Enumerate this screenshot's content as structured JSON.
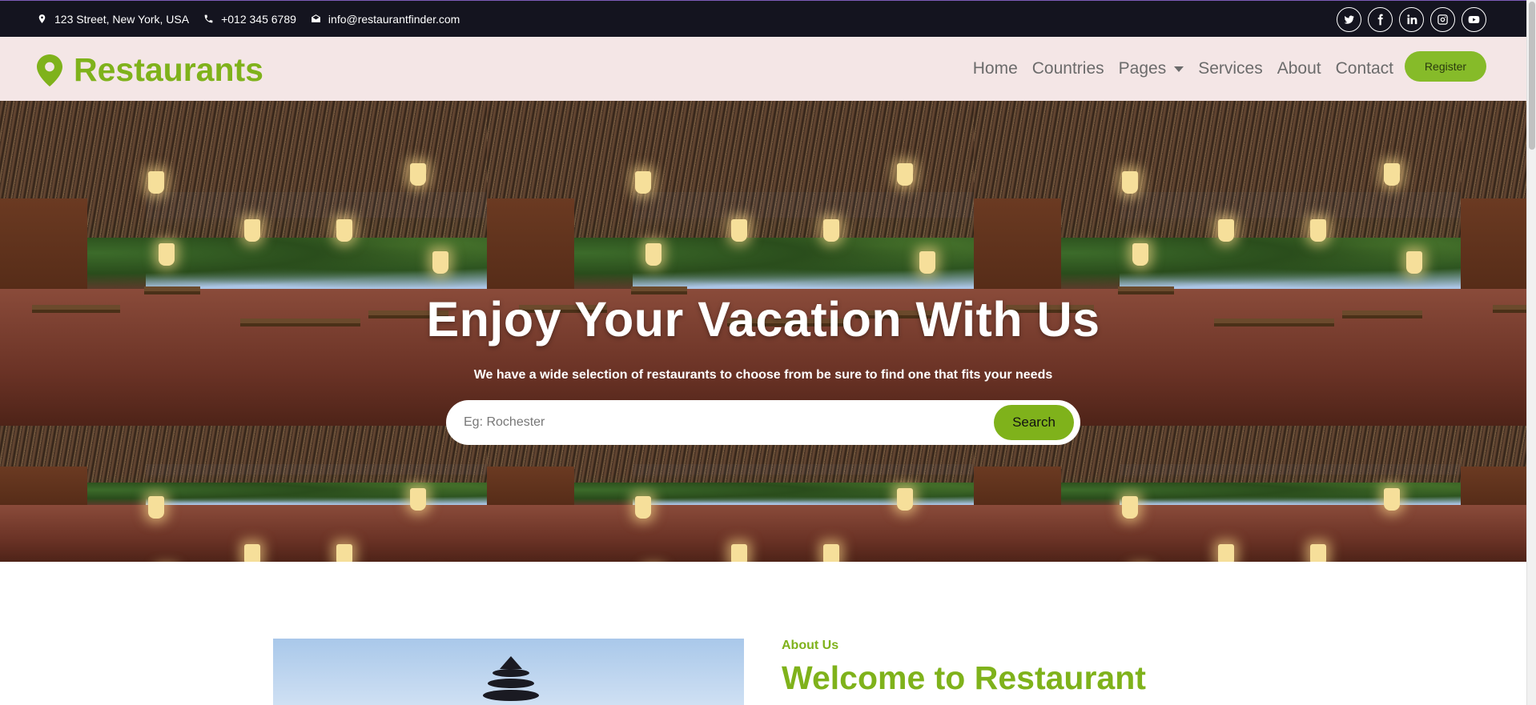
{
  "topbar": {
    "address": "123 Street, New York, USA",
    "phone": "+012 345 6789",
    "email": "info@restaurantfinder.com",
    "icons": [
      "map-marker-icon",
      "phone-icon",
      "envelope-open-icon"
    ],
    "social": [
      "twitter-icon",
      "facebook-icon",
      "linkedin-icon",
      "instagram-icon",
      "youtube-icon"
    ]
  },
  "navbar": {
    "brand": "Restaurants",
    "brand_icon": "map-marker-icon",
    "links": [
      "Home",
      "Countries",
      "Pages",
      "Services",
      "About",
      "Contact"
    ],
    "register": "Register"
  },
  "hero": {
    "title": "Enjoy Your Vacation With Us",
    "subtitle": "We have a wide selection of restaurants to choose from be sure to find one that fits your needs",
    "search_placeholder": "Eg: Rochester",
    "search_button": "Search"
  },
  "about": {
    "eyebrow": "About Us",
    "title": "Welcome to Restaurant"
  },
  "colors": {
    "accent": "#7fb21b",
    "topbar_bg": "#14141f",
    "navbar_bg": "#f4e6e6"
  }
}
